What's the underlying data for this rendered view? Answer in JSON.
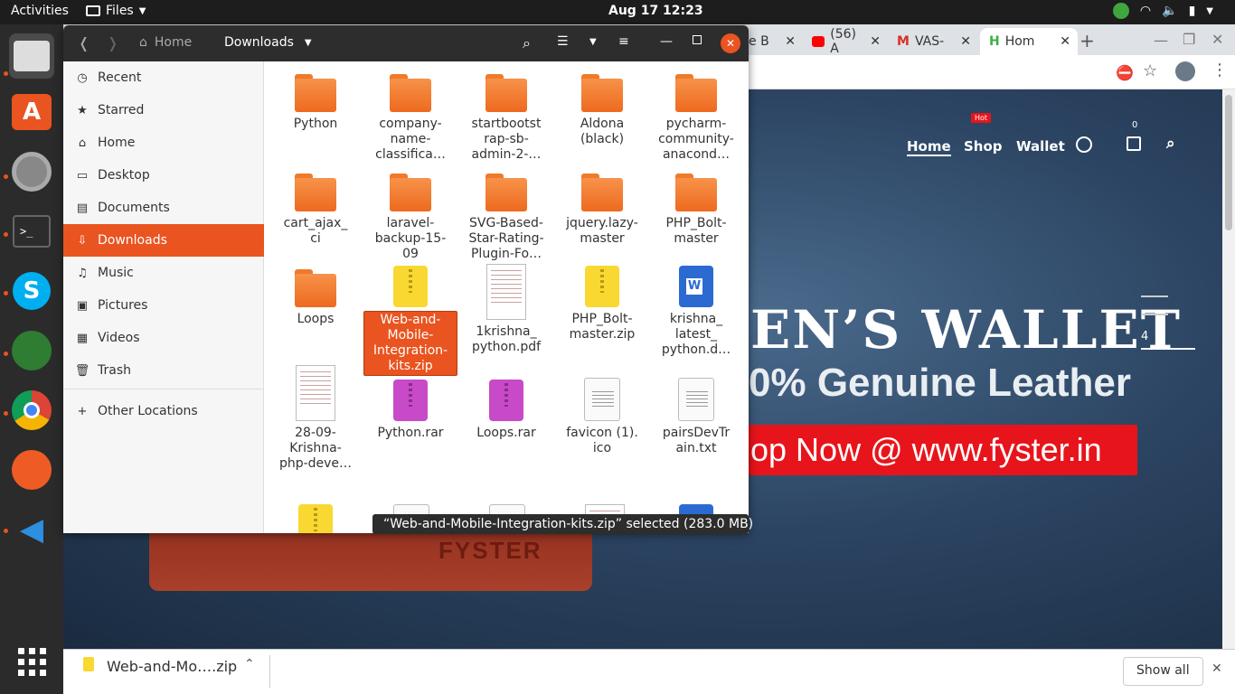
{
  "topbar": {
    "activities": "Activities",
    "app_menu": "Files",
    "clock": "Aug 17  12:23"
  },
  "files": {
    "path_home": "Home",
    "path_current": "Downloads",
    "sidebar": [
      {
        "label": "Recent",
        "icon": "clock-icon"
      },
      {
        "label": "Starred",
        "icon": "star-icon"
      },
      {
        "label": "Home",
        "icon": "home-icon"
      },
      {
        "label": "Desktop",
        "icon": "desktop-icon"
      },
      {
        "label": "Documents",
        "icon": "document-icon"
      },
      {
        "label": "Downloads",
        "icon": "download-icon"
      },
      {
        "label": "Music",
        "icon": "music-icon"
      },
      {
        "label": "Pictures",
        "icon": "picture-icon"
      },
      {
        "label": "Videos",
        "icon": "video-icon"
      },
      {
        "label": "Trash",
        "icon": "trash-icon"
      },
      {
        "label": "Other Locations",
        "icon": "plus-icon"
      }
    ],
    "items": [
      {
        "name": "Python",
        "type": "folder"
      },
      {
        "name": "company-\nname-\nclassifica…",
        "type": "folder"
      },
      {
        "name": "startbootst\nrap-sb-\nadmin-2-…",
        "type": "folder"
      },
      {
        "name": "Aldona\n(black)",
        "type": "folder"
      },
      {
        "name": "pycharm-\ncommunity-\nanacond…",
        "type": "folder"
      },
      {
        "name": "cart_ajax_\nci",
        "type": "folder"
      },
      {
        "name": "laravel-\nbackup-15-\n09",
        "type": "folder"
      },
      {
        "name": "SVG-Based-\nStar-Rating-\nPlugin-Fo…",
        "type": "folder"
      },
      {
        "name": "jquery.lazy-\nmaster",
        "type": "folder"
      },
      {
        "name": "PHP_Bolt-\nmaster",
        "type": "folder"
      },
      {
        "name": "Loops",
        "type": "folder"
      },
      {
        "name": "Web-and-\nMobile-\nIntegration-\nkits.zip",
        "type": "zip",
        "selected": true
      },
      {
        "name": "1krishna_\npython.pdf",
        "type": "pdf"
      },
      {
        "name": "PHP_Bolt-\nmaster.zip",
        "type": "zip"
      },
      {
        "name": "krishna_\nlatest_\npython.d…",
        "type": "word"
      },
      {
        "name": "28-09-\nKrishna-\nphp-deve…",
        "type": "pdf"
      },
      {
        "name": "Python.rar",
        "type": "rar"
      },
      {
        "name": "Loops.rar",
        "type": "rar"
      },
      {
        "name": "favicon (1).\nico",
        "type": "doc"
      },
      {
        "name": "pairsDevTr\nain.txt",
        "type": "doc"
      }
    ],
    "status": "“Web-and-Mobile-Integration-kits.zip” selected  (283.0 MB)"
  },
  "browser": {
    "tabs": [
      {
        "label": "e B"
      },
      {
        "label": "(56) A"
      },
      {
        "label": "VAS-"
      },
      {
        "label": "Hom"
      }
    ],
    "nav": [
      "Home",
      "Shop",
      "Wallet"
    ],
    "hot_badge": "Hot",
    "cart_count": "0",
    "hero_title": "EN’S WALLET",
    "hero_sub": "0% Genuine Leather",
    "shop_button": "op Now @ www.fyster.in",
    "slider_num": "4",
    "wallet_brand": "FYSTER",
    "download_file": "Web-and-Mo….zip",
    "show_all": "Show all"
  },
  "colors": {
    "accent": "#e95420",
    "shop_red": "#e8141b"
  }
}
